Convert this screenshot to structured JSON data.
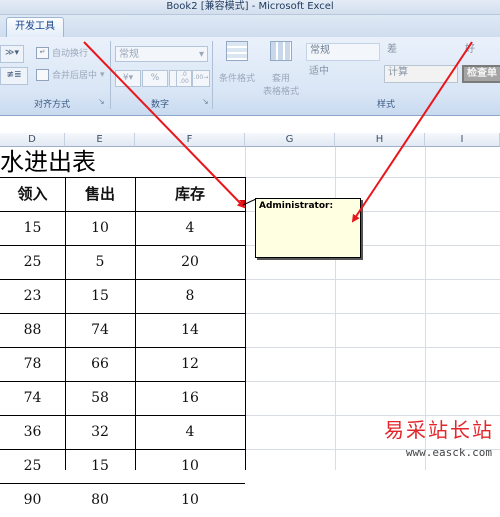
{
  "window": {
    "title": "Book2  [兼容模式] - Microsoft Excel"
  },
  "ribbon": {
    "active_tab": "开发工具",
    "alignment": {
      "wrap_text": "自动换行",
      "merge_center": "合并后居中",
      "group_label": "对齐方式"
    },
    "number": {
      "format_value": "常规",
      "percent": "%",
      "comma": ",",
      "increase_decimal": ".0\n.00",
      "group_label": "数字"
    },
    "styles": {
      "conditional_format": "条件格式",
      "format_as_table_1": "套用",
      "format_as_table_2": "表格格式",
      "cells": [
        {
          "label": "常规"
        },
        {
          "label": "差"
        },
        {
          "label": "好"
        },
        {
          "label": "适中"
        },
        {
          "label": "计算"
        },
        {
          "label": "检查单"
        }
      ],
      "group_label": "样式"
    }
  },
  "grid": {
    "columns": [
      "D",
      "E",
      "F",
      "G",
      "H",
      "I"
    ],
    "sheet_title": "水进出表",
    "headers": [
      "领入",
      "售出",
      "库存"
    ],
    "rows": [
      [
        "15",
        "10",
        "4"
      ],
      [
        "25",
        "5",
        "20"
      ],
      [
        "23",
        "15",
        "8"
      ],
      [
        "88",
        "74",
        "14"
      ],
      [
        "78",
        "66",
        "12"
      ],
      [
        "74",
        "58",
        "16"
      ],
      [
        "36",
        "32",
        "4"
      ],
      [
        "25",
        "15",
        "10"
      ],
      [
        "90",
        "80",
        "10"
      ]
    ]
  },
  "comment": {
    "author": "Administrator:"
  },
  "watermark": {
    "text": "易采站长站",
    "url": "www.easck.com"
  },
  "colors": {
    "arrow": "#e8161b",
    "comment_bg": "#ffffe1"
  }
}
